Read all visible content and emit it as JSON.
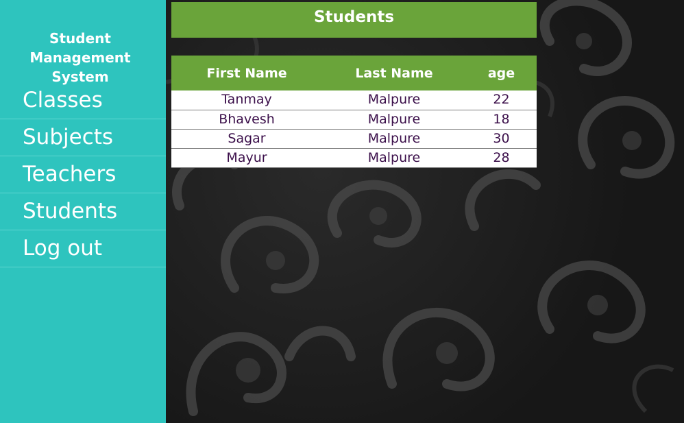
{
  "sidebar": {
    "title": "Student Management System",
    "items": [
      {
        "label": "Classes"
      },
      {
        "label": "Subjects"
      },
      {
        "label": "Teachers"
      },
      {
        "label": "Students"
      },
      {
        "label": "Log out"
      }
    ]
  },
  "main": {
    "header": "Students",
    "table": {
      "columns": [
        "First Name",
        "Last Name",
        "age"
      ],
      "rows": [
        [
          "Tanmay",
          "Malpure",
          "22"
        ],
        [
          "Bhavesh",
          "Malpure",
          "18"
        ],
        [
          "Sagar",
          "Malpure",
          "30"
        ],
        [
          "Mayur",
          "Malpure",
          "28"
        ]
      ]
    }
  },
  "colors": {
    "sidebar_bg": "#2ec4be",
    "accent_green": "#6aa43a",
    "cell_text": "#3b0f4a",
    "background": "#1b1b1b"
  }
}
